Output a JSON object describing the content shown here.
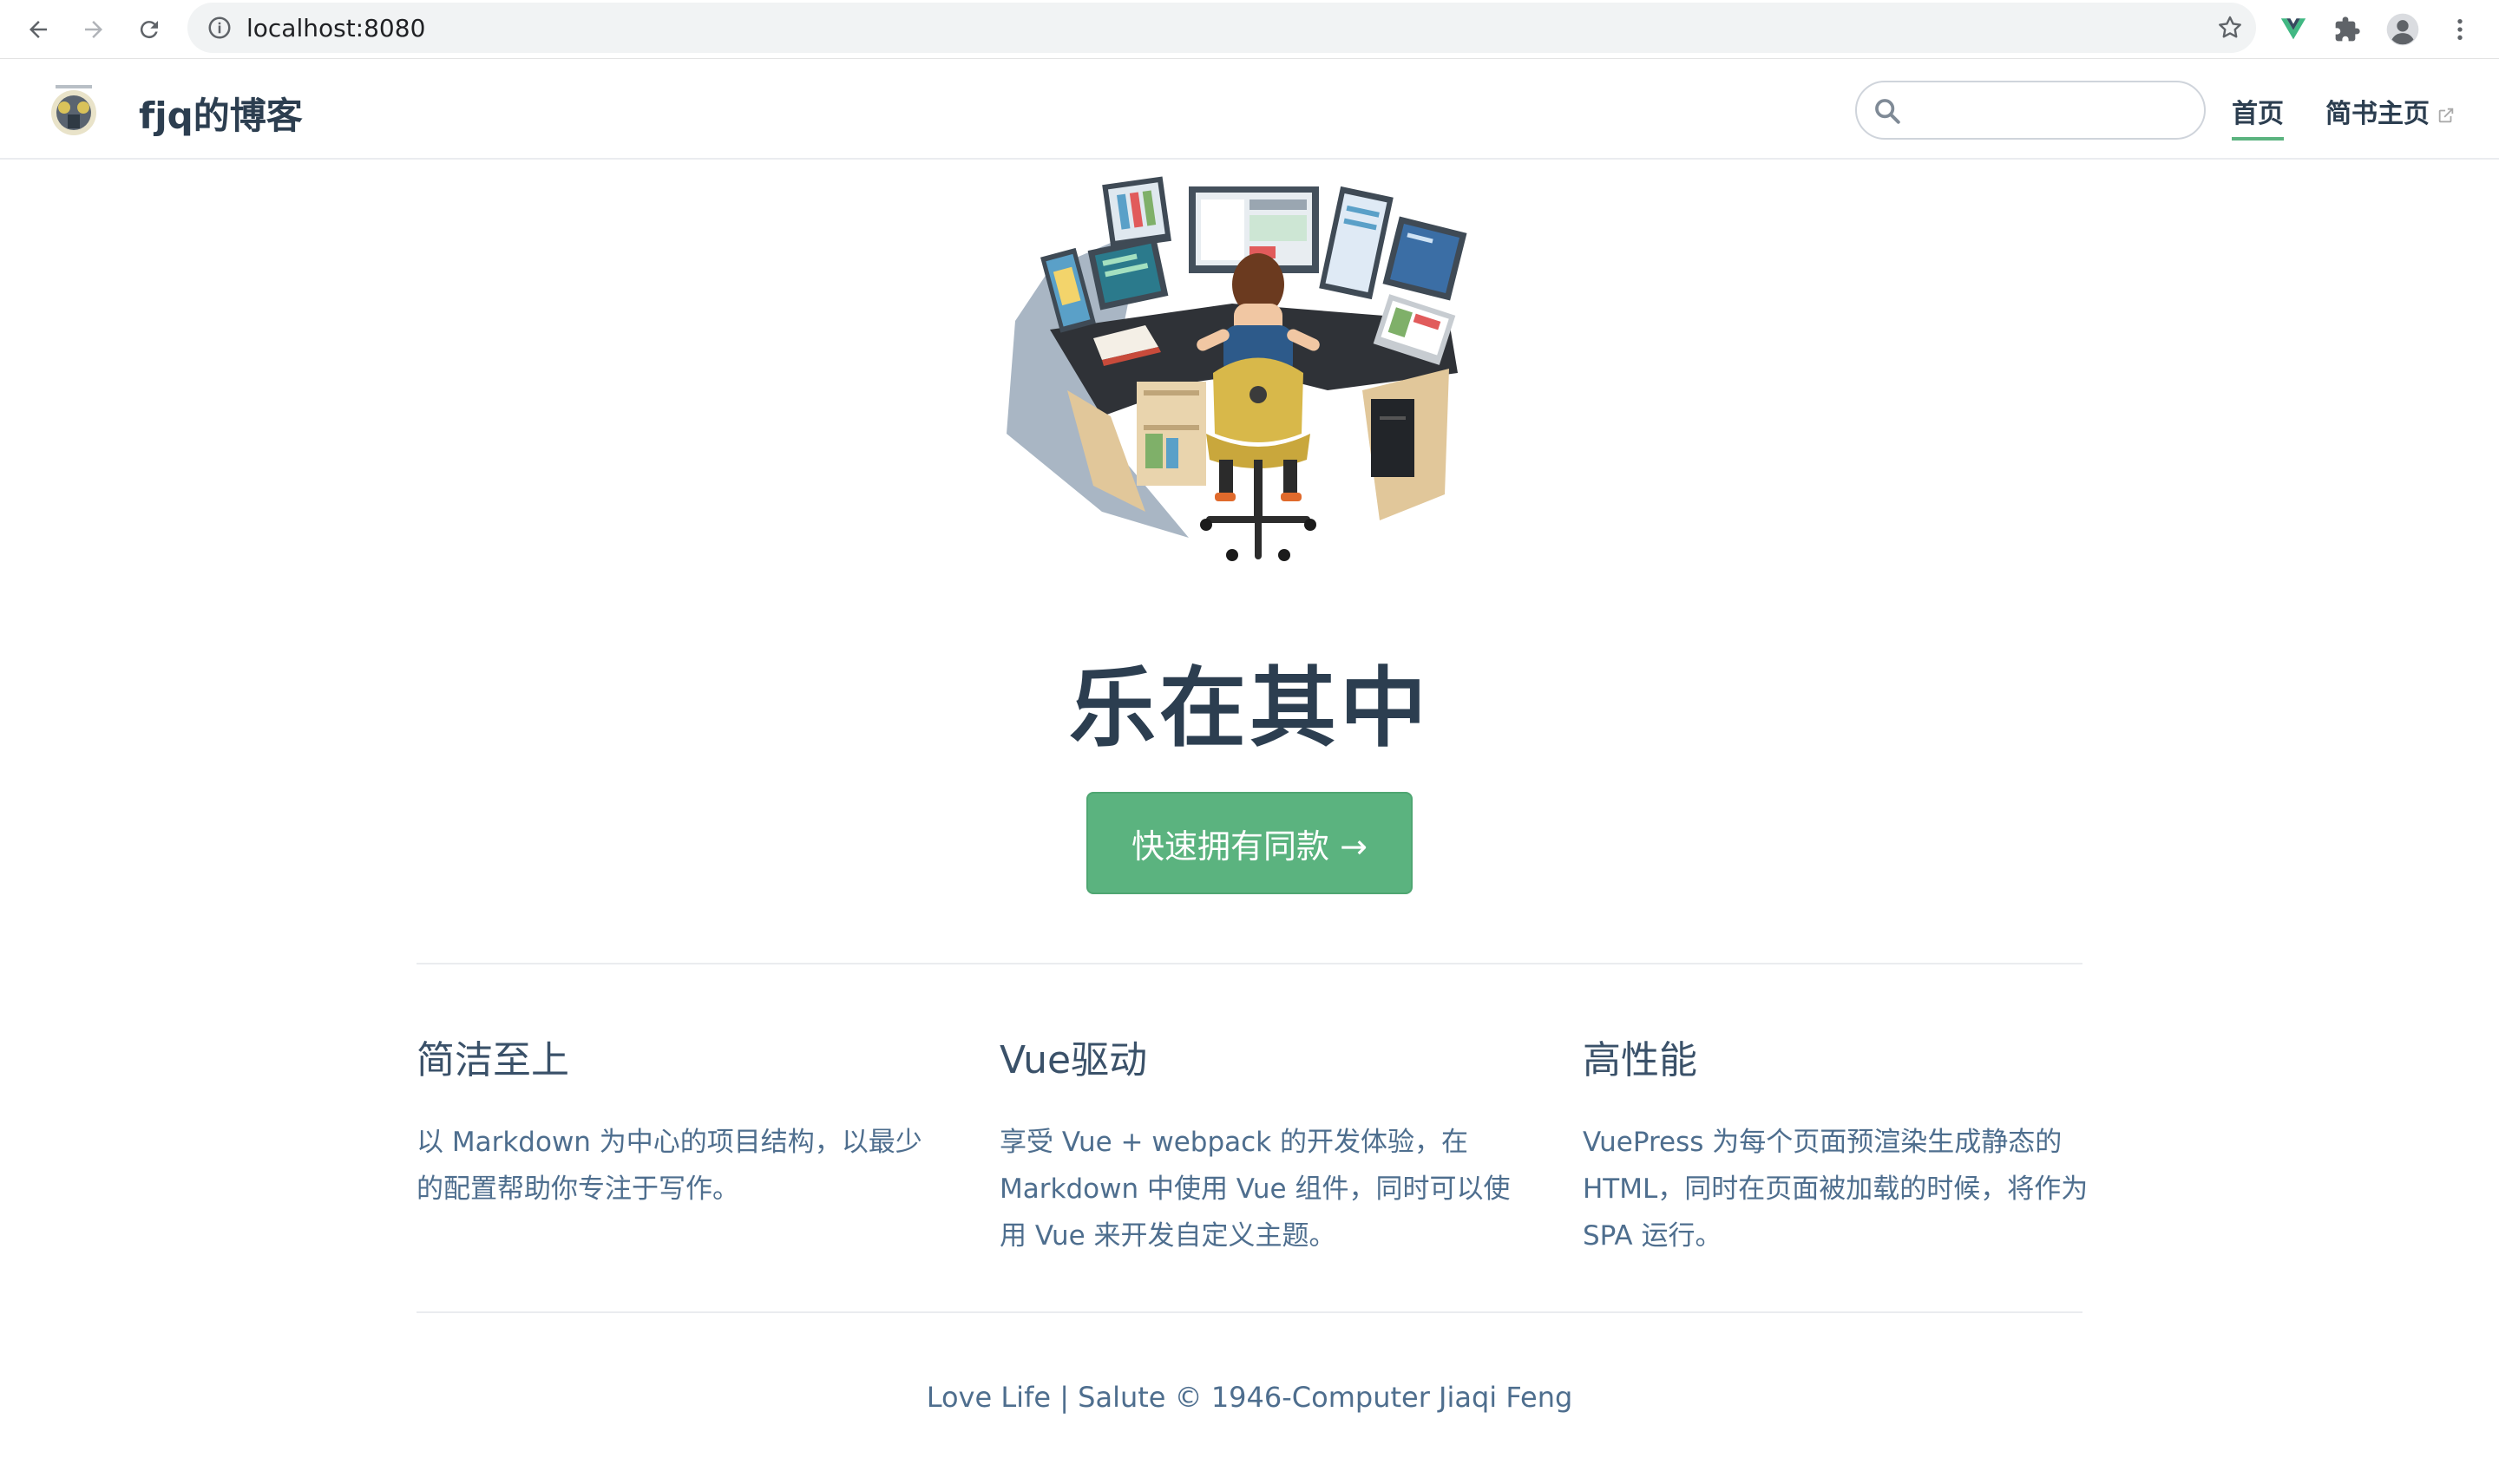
{
  "browser": {
    "url": "localhost:8080",
    "icons": [
      "back-icon",
      "forward-icon",
      "reload-icon",
      "info-icon",
      "bookmark-star-icon",
      "vue-devtools-icon",
      "extensions-puzzle-icon",
      "profile-avatar-icon",
      "more-menu-icon"
    ]
  },
  "navbar": {
    "site_name": "fjq的博客",
    "search_placeholder": "",
    "links": [
      {
        "label": "首页",
        "active": true
      },
      {
        "label": "简书主页",
        "external": true
      }
    ]
  },
  "hero": {
    "title": "乐在其中",
    "cta_label": "快速拥有同款 →"
  },
  "features": [
    {
      "title": "简洁至上",
      "details": "以 Markdown 为中心的项目结构，以最少的配置帮助你专注于写作。"
    },
    {
      "title": "Vue驱动",
      "details": "享受 Vue + webpack 的开发体验，在 Markdown 中使用 Vue 组件，同时可以使用 Vue 来开发自定义主题。"
    },
    {
      "title": "高性能",
      "details": "VuePress 为每个页面预渲染生成静态的 HTML，同时在页面被加载的时候，将作为 SPA 运行。"
    }
  ],
  "footer": "Love Life | Salute © 1946-Computer Jiaqi Feng",
  "colors": {
    "accent": "#5bb37f",
    "text": "#2c3e50",
    "muted": "#4e6e8e"
  }
}
